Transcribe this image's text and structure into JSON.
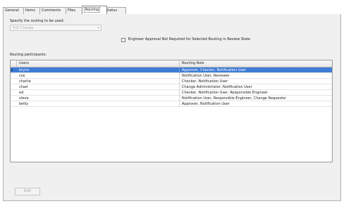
{
  "tabs": [
    {
      "label": "General"
    },
    {
      "label": "Items"
    },
    {
      "label": "Comments"
    },
    {
      "label": "Files"
    },
    {
      "label": "Routing"
    },
    {
      "label": "Status"
    }
  ],
  "active_tab": "Routing",
  "routing_source": {
    "label": "Specify the routing to be used:",
    "select_value": "Full Change",
    "arrow": "▾"
  },
  "engineer_approval": {
    "label": "Engineer Approval Not Required for Selected Routing in Review State",
    "checked": false
  },
  "participants": {
    "label": "Routing participants:",
    "columns": [
      "Users",
      "Routing Role"
    ],
    "rows": [
      {
        "user": "brynn",
        "role": "Approver, Checker, Notification User",
        "selected": true
      },
      {
        "user": "cos",
        "role": "Notification User, Reviewer",
        "selected": false
      },
      {
        "user": "charlie",
        "role": "Checker, Notification User",
        "selected": false
      },
      {
        "user": "chad",
        "role": "Change Administrator, Notification User",
        "selected": false
      },
      {
        "user": "ed",
        "role": "Checker, Notification User, Responsible Engineer",
        "selected": false
      },
      {
        "user": "steve",
        "role": "Notification User, Responsible Engineer, Change Requester",
        "selected": false
      },
      {
        "user": "betty",
        "role": "Approver, Notification User",
        "selected": false
      }
    ],
    "row_marker": "▸"
  },
  "edit_button": {
    "label": "Edit"
  }
}
